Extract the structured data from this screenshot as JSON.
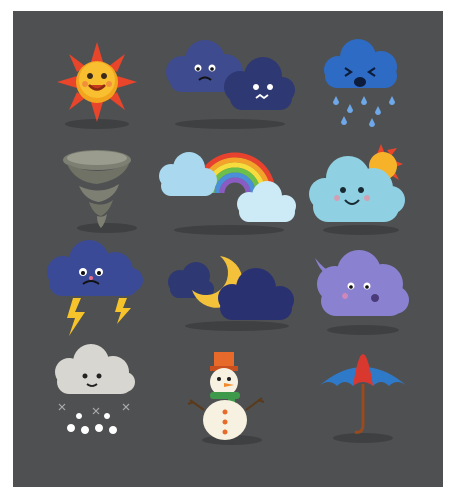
{
  "background": {
    "frame_color": "#4f5052",
    "page_color": "#ffffff"
  },
  "icons": [
    {
      "name": "smiling-sun-icon"
    },
    {
      "name": "two-sad-storm-clouds-icon"
    },
    {
      "name": "crying-rain-cloud-icon"
    },
    {
      "name": "tornado-icon"
    },
    {
      "name": "rainbow-with-clouds-icon"
    },
    {
      "name": "happy-cloud-with-sun-icon"
    },
    {
      "name": "angry-thunder-cloud-icon"
    },
    {
      "name": "crescent-moon-night-clouds-icon"
    },
    {
      "name": "blowing-wind-cloud-icon"
    },
    {
      "name": "snow-cloud-icon"
    },
    {
      "name": "snowman-icon"
    },
    {
      "name": "umbrella-icon"
    }
  ]
}
